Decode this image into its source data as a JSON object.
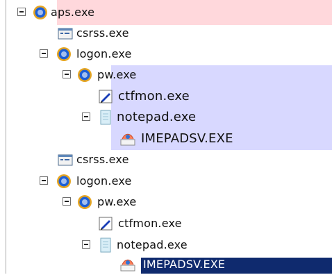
{
  "colors": {
    "root_highlight": "#ffd8dc",
    "pw_highlight": "#d8d8ff",
    "selection": "#0f2a6e",
    "text": "#111111",
    "selected_text": "#ffffff"
  },
  "tree": {
    "nodes": [
      {
        "label": "aps.exe",
        "icon": "globe-gear-icon",
        "expanded": true
      },
      {
        "label": "csrss.exe",
        "icon": "window-icon"
      },
      {
        "label": "logon.exe",
        "icon": "globe-gear-icon",
        "expanded": true
      },
      {
        "label": "pw.exe",
        "icon": "globe-gear-icon",
        "expanded": true
      },
      {
        "label": "ctfmon.exe",
        "icon": "pen-icon"
      },
      {
        "label": "notepad.exe",
        "icon": "notepad-icon",
        "expanded": true
      },
      {
        "label": "IMEPADSV.EXE",
        "icon": "ime-pad-icon"
      },
      {
        "label": "csrss.exe",
        "icon": "window-icon"
      },
      {
        "label": "logon.exe",
        "icon": "globe-gear-icon",
        "expanded": true
      },
      {
        "label": "pw.exe",
        "icon": "globe-gear-icon",
        "expanded": true
      },
      {
        "label": "ctfmon.exe",
        "icon": "pen-icon"
      },
      {
        "label": "notepad.exe",
        "icon": "notepad-icon",
        "expanded": true
      },
      {
        "label": "IMEPADSV.EXE",
        "icon": "ime-pad-icon",
        "selected": true
      }
    ]
  }
}
